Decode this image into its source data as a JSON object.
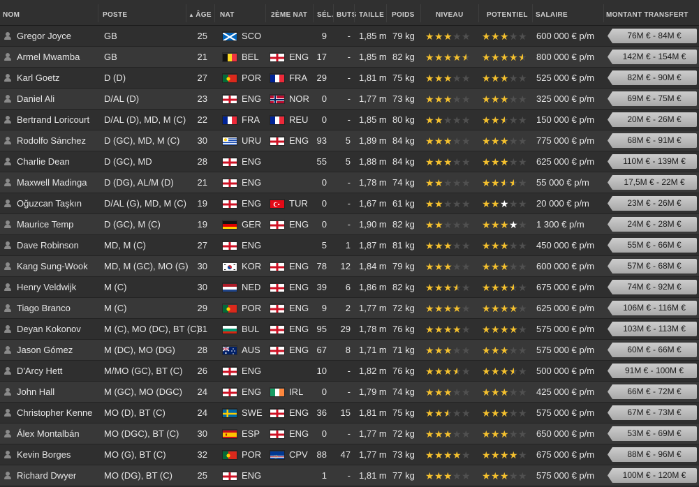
{
  "columns": {
    "nom": "NOM",
    "poste": "POSTE",
    "age": "ÂGE",
    "nat": "NAT",
    "nat2": "2ÈME NAT",
    "sel": "SÉL.",
    "buts": "BUTS",
    "taille": "TAILLE",
    "poids": "POIDS",
    "niveau": "NIVEAU",
    "potentiel": "POTENTIEL",
    "salaire": "SALAIRE",
    "transfert": "MONTANT TRANSFERT"
  },
  "colors": {
    "star": "#f5c12e",
    "star_empty": "#505050",
    "tag_bg": "#bdbdbd"
  },
  "players": [
    {
      "nom": "Gregor Joyce",
      "poste": "GB",
      "age": "25",
      "nat": "SCO",
      "nat_flag": "sco",
      "nat2": "",
      "nat2_flag": "",
      "sel": "9",
      "buts": "-",
      "taille": "1,85 m",
      "poids": "79 kg",
      "niveau": 3,
      "potentiel": 3,
      "potentiel_white": 0,
      "salaire": "600 000 € p/m",
      "transfert": "76M € - 84M €"
    },
    {
      "nom": "Armel Mwamba",
      "poste": "GB",
      "age": "21",
      "nat": "BEL",
      "nat_flag": "bel",
      "nat2": "ENG",
      "nat2_flag": "eng",
      "sel": "17",
      "buts": "-",
      "taille": "1,85 m",
      "poids": "82 kg",
      "niveau": 4.5,
      "potentiel": 4.5,
      "potentiel_white": 0,
      "salaire": "800 000 € p/m",
      "transfert": "142M € - 154M €"
    },
    {
      "nom": "Karl Goetz",
      "poste": "D (D)",
      "age": "27",
      "nat": "POR",
      "nat_flag": "por",
      "nat2": "FRA",
      "nat2_flag": "fra",
      "sel": "29",
      "buts": "-",
      "taille": "1,81 m",
      "poids": "75 kg",
      "niveau": 3,
      "potentiel": 3,
      "potentiel_white": 0,
      "salaire": "525 000 € p/m",
      "transfert": "82M € - 90M €"
    },
    {
      "nom": "Daniel Ali",
      "poste": "D/AL (D)",
      "age": "23",
      "nat": "ENG",
      "nat_flag": "eng",
      "nat2": "NOR",
      "nat2_flag": "nor",
      "sel": "0",
      "buts": "-",
      "taille": "1,77 m",
      "poids": "73 kg",
      "niveau": 3,
      "potentiel": 3,
      "potentiel_white": 0,
      "salaire": "325 000 € p/m",
      "transfert": "69M € - 75M €"
    },
    {
      "nom": "Bertrand Loricourt",
      "poste": "D/AL (D), MD, M (C)",
      "age": "22",
      "nat": "FRA",
      "nat_flag": "fra",
      "nat2": "REU",
      "nat2_flag": "fra",
      "sel": "0",
      "buts": "-",
      "taille": "1,85 m",
      "poids": "80 kg",
      "niveau": 2,
      "potentiel": 2.5,
      "potentiel_white": 0,
      "salaire": "150 000 € p/m",
      "transfert": "20M € - 26M €"
    },
    {
      "nom": "Rodolfo Sánchez",
      "poste": "D (GC), MD, M (C)",
      "age": "30",
      "nat": "URU",
      "nat_flag": "uru",
      "nat2": "ENG",
      "nat2_flag": "eng",
      "sel": "93",
      "buts": "5",
      "taille": "1,89 m",
      "poids": "84 kg",
      "niveau": 3,
      "potentiel": 3,
      "potentiel_white": 0,
      "salaire": "775 000 € p/m",
      "transfert": "68M € - 91M €"
    },
    {
      "nom": "Charlie Dean",
      "poste": "D (GC), MD",
      "age": "28",
      "nat": "ENG",
      "nat_flag": "eng",
      "nat2": "",
      "nat2_flag": "",
      "sel": "55",
      "buts": "5",
      "taille": "1,88 m",
      "poids": "84 kg",
      "niveau": 3,
      "potentiel": 3,
      "potentiel_white": 0,
      "salaire": "625 000 € p/m",
      "transfert": "110M € - 139M €"
    },
    {
      "nom": "Maxwell Madinga",
      "poste": "D (DG), AL/M (D)",
      "age": "21",
      "nat": "ENG",
      "nat_flag": "eng",
      "nat2": "",
      "nat2_flag": "",
      "sel": "0",
      "buts": "-",
      "taille": "1,78 m",
      "poids": "74 kg",
      "niveau": 2,
      "potentiel": 2.5,
      "potentiel_white": 0.5,
      "salaire": "55 000 € p/m",
      "transfert": "17,5M € - 22M €"
    },
    {
      "nom": "Oğuzcan Taşkın",
      "poste": "D/AL (G), MD, M (C)",
      "age": "19",
      "nat": "ENG",
      "nat_flag": "eng",
      "nat2": "TUR",
      "nat2_flag": "tur",
      "sel": "0",
      "buts": "-",
      "taille": "1,67 m",
      "poids": "61 kg",
      "niveau": 2,
      "potentiel": 2,
      "potentiel_white": 1,
      "salaire": "20 000 € p/m",
      "transfert": "23M € - 26M €"
    },
    {
      "nom": "Maurice Temp",
      "poste": "D (GC), M (C)",
      "age": "19",
      "nat": "GER",
      "nat_flag": "ger",
      "nat2": "ENG",
      "nat2_flag": "eng",
      "sel": "0",
      "buts": "-",
      "taille": "1,90 m",
      "poids": "82 kg",
      "niveau": 2,
      "potentiel": 3,
      "potentiel_white": 1,
      "salaire": "1 300 € p/m",
      "transfert": "24M € - 28M €"
    },
    {
      "nom": "Dave Robinson",
      "poste": "MD, M (C)",
      "age": "27",
      "nat": "ENG",
      "nat_flag": "eng",
      "nat2": "",
      "nat2_flag": "",
      "sel": "5",
      "buts": "1",
      "taille": "1,87 m",
      "poids": "81 kg",
      "niveau": 3,
      "potentiel": 3,
      "potentiel_white": 0,
      "salaire": "450 000 € p/m",
      "transfert": "55M € - 66M €"
    },
    {
      "nom": "Kang Sung-Wook",
      "poste": "MD, M (GC), MO (G)",
      "age": "30",
      "nat": "KOR",
      "nat_flag": "kor",
      "nat2": "ENG",
      "nat2_flag": "eng",
      "sel": "78",
      "buts": "12",
      "taille": "1,84 m",
      "poids": "79 kg",
      "niveau": 3,
      "potentiel": 3,
      "potentiel_white": 0,
      "salaire": "600 000 € p/m",
      "transfert": "57M € - 68M €"
    },
    {
      "nom": "Henry Veldwijk",
      "poste": "M (C)",
      "age": "30",
      "nat": "NED",
      "nat_flag": "ned",
      "nat2": "ENG",
      "nat2_flag": "eng",
      "sel": "39",
      "buts": "6",
      "taille": "1,86 m",
      "poids": "82 kg",
      "niveau": 3.5,
      "potentiel": 3.5,
      "potentiel_white": 0,
      "salaire": "675 000 € p/m",
      "transfert": "74M € - 92M €"
    },
    {
      "nom": "Tiago Branco",
      "poste": "M (C)",
      "age": "29",
      "nat": "POR",
      "nat_flag": "por",
      "nat2": "ENG",
      "nat2_flag": "eng",
      "sel": "9",
      "buts": "2",
      "taille": "1,77 m",
      "poids": "72 kg",
      "niveau": 4,
      "potentiel": 4,
      "potentiel_white": 0,
      "salaire": "625 000 € p/m",
      "transfert": "106M € - 116M €"
    },
    {
      "nom": "Deyan Kokonov",
      "poste": "M (C), MO (DC), BT (C)",
      "age": "31",
      "nat": "BUL",
      "nat_flag": "bul",
      "nat2": "ENG",
      "nat2_flag": "eng",
      "sel": "95",
      "buts": "29",
      "taille": "1,78 m",
      "poids": "76 kg",
      "niveau": 4,
      "potentiel": 4,
      "potentiel_white": 0,
      "salaire": "575 000 € p/m",
      "transfert": "103M € - 113M €"
    },
    {
      "nom": "Jason Gómez",
      "poste": "M (DC), MO (DG)",
      "age": "28",
      "nat": "AUS",
      "nat_flag": "aus",
      "nat2": "ENG",
      "nat2_flag": "eng",
      "sel": "67",
      "buts": "8",
      "taille": "1,71 m",
      "poids": "71 kg",
      "niveau": 3,
      "potentiel": 3,
      "potentiel_white": 0,
      "salaire": "575 000 € p/m",
      "transfert": "60M € - 66M €"
    },
    {
      "nom": "D'Arcy Hett",
      "poste": "M/MO (GC), BT (C)",
      "age": "26",
      "nat": "ENG",
      "nat_flag": "eng",
      "nat2": "",
      "nat2_flag": "",
      "sel": "10",
      "buts": "-",
      "taille": "1,82 m",
      "poids": "76 kg",
      "niveau": 3.5,
      "potentiel": 3.5,
      "potentiel_white": 0,
      "salaire": "500 000 € p/m",
      "transfert": "91M € - 100M €"
    },
    {
      "nom": "John Hall",
      "poste": "M (GC), MO (DGC)",
      "age": "24",
      "nat": "ENG",
      "nat_flag": "eng",
      "nat2": "IRL",
      "nat2_flag": "irl",
      "sel": "0",
      "buts": "-",
      "taille": "1,79 m",
      "poids": "74 kg",
      "niveau": 3,
      "potentiel": 3,
      "potentiel_white": 0,
      "salaire": "425 000 € p/m",
      "transfert": "66M € - 72M €"
    },
    {
      "nom": "Christopher Kenne",
      "poste": "MO (D), BT (C)",
      "age": "24",
      "nat": "SWE",
      "nat_flag": "swe",
      "nat2": "ENG",
      "nat2_flag": "eng",
      "sel": "36",
      "buts": "15",
      "taille": "1,81 m",
      "poids": "75 kg",
      "niveau": 2.5,
      "potentiel": 3,
      "potentiel_white": 0,
      "salaire": "575 000 € p/m",
      "transfert": "67M € - 73M €"
    },
    {
      "nom": "Álex Montalbán",
      "poste": "MO (DGC), BT (C)",
      "age": "30",
      "nat": "ESP",
      "nat_flag": "esp",
      "nat2": "ENG",
      "nat2_flag": "eng",
      "sel": "0",
      "buts": "-",
      "taille": "1,77 m",
      "poids": "72 kg",
      "niveau": 3,
      "potentiel": 3,
      "potentiel_white": 0,
      "salaire": "650 000 € p/m",
      "transfert": "53M € - 69M €"
    },
    {
      "nom": "Kevin Borges",
      "poste": "MO (G), BT (C)",
      "age": "32",
      "nat": "POR",
      "nat_flag": "por",
      "nat2": "CPV",
      "nat2_flag": "cpv",
      "sel": "88",
      "buts": "47",
      "taille": "1,77 m",
      "poids": "73 kg",
      "niveau": 4,
      "potentiel": 4,
      "potentiel_white": 0,
      "salaire": "675 000 € p/m",
      "transfert": "88M € - 96M €"
    },
    {
      "nom": "Richard Dwyer",
      "poste": "MO (DG), BT (C)",
      "age": "25",
      "nat": "ENG",
      "nat_flag": "eng",
      "nat2": "",
      "nat2_flag": "",
      "sel": "1",
      "buts": "-",
      "taille": "1,81 m",
      "poids": "77 kg",
      "niveau": 3,
      "potentiel": 3,
      "potentiel_white": 0,
      "salaire": "575 000 € p/m",
      "transfert": "100M € - 120M €"
    }
  ]
}
